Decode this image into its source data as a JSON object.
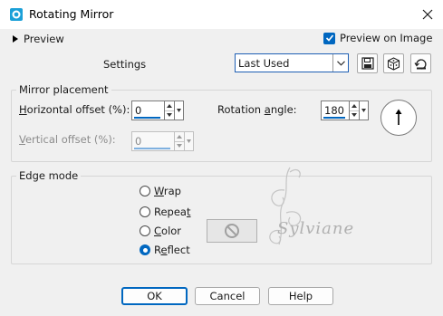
{
  "window": {
    "title": "Rotating Mirror"
  },
  "preview": {
    "toggle_label": "Preview",
    "on_image_label": "Preview on Image",
    "on_image_checked": true
  },
  "settings": {
    "label": "Settings",
    "preset_value": "Last Used"
  },
  "mirror_placement": {
    "title": "Mirror placement",
    "horizontal_offset": {
      "label_prefix": "H",
      "label_rest": "orizontal offset (%):",
      "value": "0"
    },
    "vertical_offset": {
      "label_prefix": "V",
      "label_rest": "ertical offset (%):",
      "value": "0",
      "enabled": false
    },
    "rotation_angle": {
      "label_a": "Rotation ",
      "label_underlined": "a",
      "label_b": "ngle:",
      "value": "180"
    }
  },
  "edge_mode": {
    "title": "Edge mode",
    "options": [
      {
        "label_underlined": "W",
        "label_rest": "rap",
        "selected": false
      },
      {
        "label_a": "Repea",
        "label_underlined": "t",
        "label_b": "",
        "selected": false
      },
      {
        "label_underlined": "C",
        "label_rest": "olor",
        "selected": false
      },
      {
        "label_a": "R",
        "label_underlined": "e",
        "label_b": "flect",
        "selected": true
      }
    ]
  },
  "watermark": {
    "text": "Sylviane"
  },
  "buttons": {
    "ok": "OK",
    "cancel": "Cancel",
    "help": "Help"
  },
  "colors": {
    "accent": "#0067c0",
    "background": "#f0f0f0"
  },
  "icons": {
    "app": "mirror-app-icon",
    "close": "close-icon",
    "save_preset": "save-icon",
    "randomize": "dice-icon",
    "reset": "reset-icon",
    "no_color": "no-symbol-icon"
  }
}
